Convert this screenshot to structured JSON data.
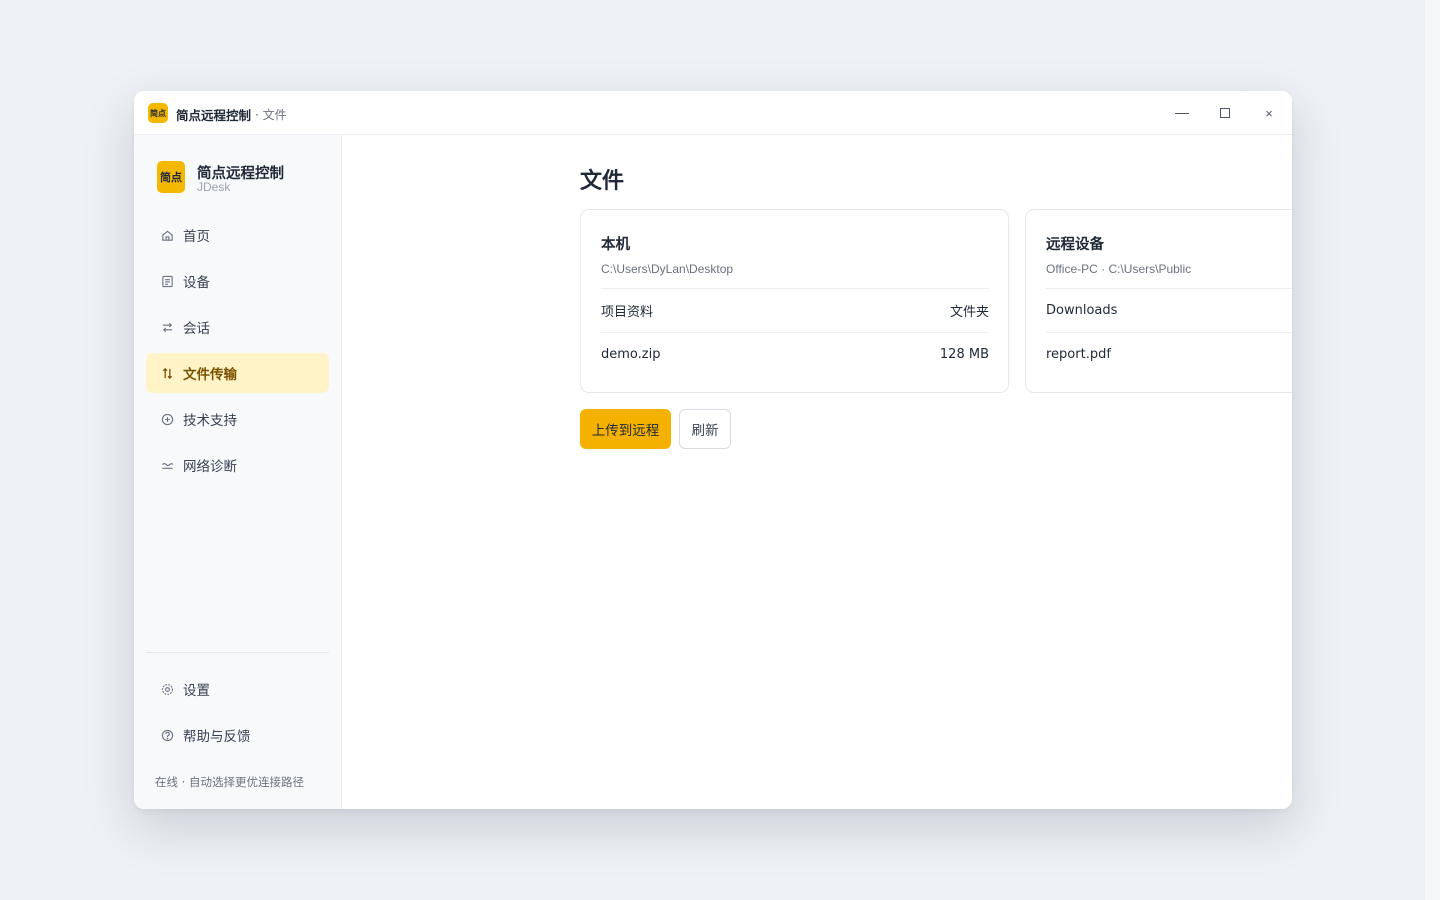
{
  "titlebar": {
    "logo_text": "简点",
    "app_name": "简点远程控制",
    "section": "· 文件",
    "close_glyph": "×"
  },
  "sidebar": {
    "brand": {
      "logo_text": "简点",
      "name": "简点远程控制",
      "sub": "JDesk"
    },
    "items": [
      {
        "label": "首页",
        "icon": "home-icon"
      },
      {
        "label": "设备",
        "icon": "device-list-icon"
      },
      {
        "label": "会话",
        "icon": "swap-icon"
      },
      {
        "label": "文件传输",
        "icon": "transfer-icon",
        "active": true
      },
      {
        "label": "技术支持",
        "icon": "support-icon"
      },
      {
        "label": "网络诊断",
        "icon": "wave-icon"
      }
    ],
    "bottom_items": [
      {
        "label": "设置",
        "icon": "settings-icon"
      },
      {
        "label": "帮助与反馈",
        "icon": "help-icon"
      }
    ],
    "status": "在线 · 自动选择更优连接路径"
  },
  "main": {
    "title": "文件",
    "local": {
      "title": "本机",
      "path": "C:\\Users\\DyLan\\Desktop",
      "rows": [
        {
          "name": "项目资料",
          "value": "文件夹"
        },
        {
          "name": "demo.zip",
          "value": "128 MB"
        }
      ]
    },
    "remote": {
      "title": "远程设备",
      "path": "Office-PC · C:\\Users\\Public",
      "rows": [
        {
          "name": "Downloads"
        },
        {
          "name": "report.pdf"
        }
      ]
    },
    "buttons": {
      "upload": "上传到远程",
      "refresh": "刷新"
    }
  },
  "colors": {
    "accent": "#f5b100",
    "active_bg": "#fff3c7",
    "active_text": "#7a5200"
  }
}
